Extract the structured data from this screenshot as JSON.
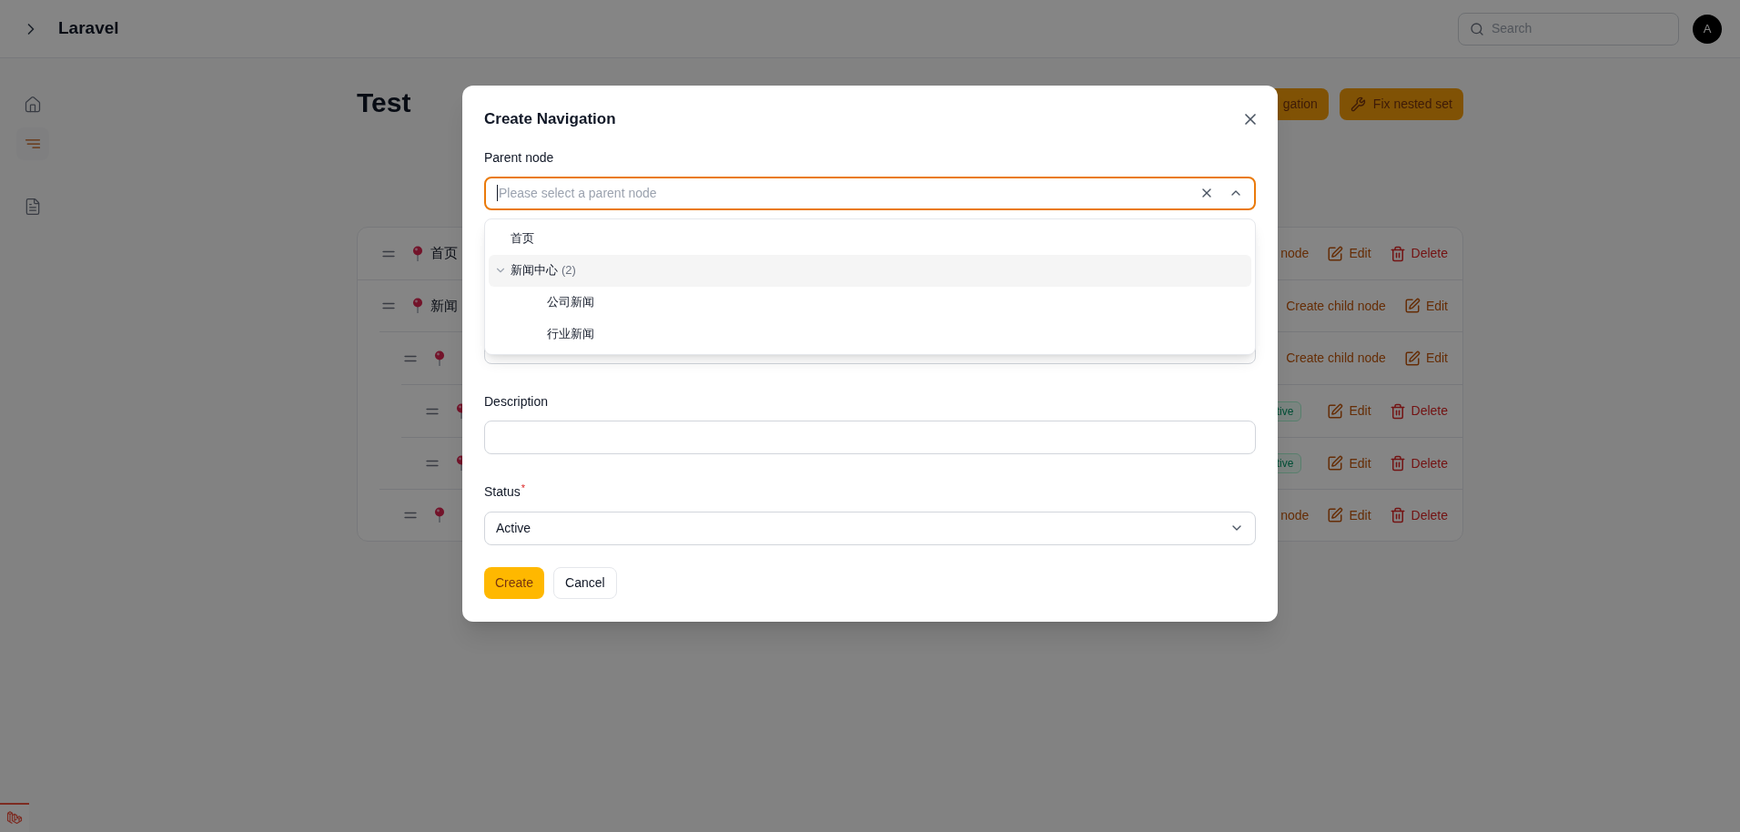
{
  "app": {
    "title": "Laravel"
  },
  "search": {
    "placeholder": "Search"
  },
  "avatar": {
    "initial": "A"
  },
  "sidebar": {
    "items": [
      {
        "kind": "home",
        "selected": false
      },
      {
        "kind": "navigation",
        "selected": true
      },
      {
        "kind": "document",
        "selected": false
      }
    ]
  },
  "page": {
    "title": "Test",
    "actions": [
      {
        "kind": "plain",
        "label": "gation"
      },
      {
        "kind": "wrench",
        "label": "Fix nested set"
      }
    ]
  },
  "tree": [
    {
      "label": "首页",
      "actions": [
        {
          "kind": "create",
          "label": "node"
        },
        {
          "kind": "edit",
          "label": "Edit"
        },
        {
          "kind": "delete",
          "label": "Delete"
        }
      ]
    },
    {
      "label": "新闻",
      "actions": [
        {
          "kind": "create",
          "label": "Create child node"
        },
        {
          "kind": "edit",
          "label": "Edit"
        }
      ],
      "children": [
        {
          "actions": [
            {
              "kind": "create",
              "label": "Create child node"
            },
            {
              "kind": "edit",
              "label": "Edit"
            }
          ],
          "children": [
            {
              "badge": "tive",
              "actions": [
                {
                  "kind": "edit",
                  "label": "Edit"
                },
                {
                  "kind": "delete",
                  "label": "Delete"
                }
              ]
            },
            {
              "badge": "tive",
              "actions": [
                {
                  "kind": "edit",
                  "label": "Edit"
                },
                {
                  "kind": "delete",
                  "label": "Delete"
                }
              ]
            }
          ]
        },
        {
          "actions": [
            {
              "kind": "create",
              "label": "node"
            },
            {
              "kind": "edit",
              "label": "Edit"
            },
            {
              "kind": "delete",
              "label": "Delete"
            }
          ]
        }
      ]
    }
  ],
  "modal": {
    "title": "Create Navigation",
    "fields": [
      {
        "kind": "tree-select",
        "label": "Parent node",
        "placeholder": "Please select a parent node",
        "expanded": true,
        "options": [
          {
            "label": "首页",
            "active": false
          },
          {
            "label": "新闻中心",
            "count": "(2)",
            "active": true,
            "expanded": true,
            "children": [
              {
                "label": "公司新闻",
                "active": false
              },
              {
                "label": "行业新闻",
                "active": false
              }
            ]
          }
        ]
      },
      {
        "kind": "text"
      },
      {
        "kind": "text",
        "label": "Description"
      },
      {
        "kind": "select",
        "label": "Status",
        "required_mark": "*",
        "value": "Active"
      }
    ],
    "buttons": [
      {
        "kind": "primary",
        "label": "Create"
      },
      {
        "kind": "secondary",
        "label": "Cancel"
      }
    ]
  }
}
